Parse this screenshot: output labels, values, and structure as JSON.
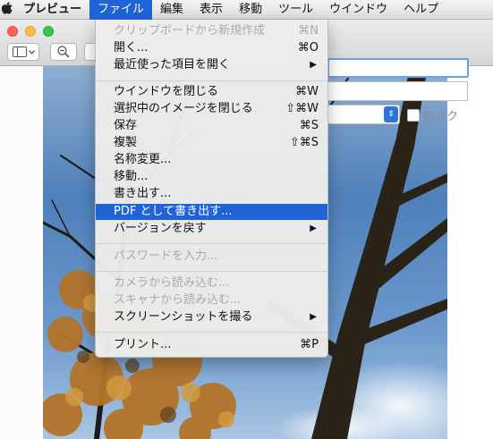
{
  "menubar": {
    "apple_icon": "apple-logo-icon",
    "items": [
      "プレビュー",
      "ファイル",
      "編集",
      "表示",
      "移動",
      "ツール",
      "ウインドウ",
      "ヘルプ"
    ]
  },
  "toolbar": {
    "sidebar_icon": "sidebar-toggle-icon",
    "chevron_icon": "chevron-down-icon",
    "zoom_icon": "zoom-out-icon"
  },
  "inspector": {
    "lock_label": "ロック",
    "select_icon": "updown-chevron-icon"
  },
  "file_menu": {
    "items": [
      {
        "label": "クリップボードから新規作成",
        "shortcut": "⌘N",
        "enabled": false
      },
      {
        "label": "開く...",
        "shortcut": "⌘O",
        "enabled": true
      },
      {
        "label": "最近使った項目を開く",
        "shortcut": "",
        "submenu": true,
        "enabled": true
      },
      {
        "label": "ウインドウを閉じる",
        "shortcut": "⌘W",
        "enabled": true
      },
      {
        "label": "選択中のイメージを閉じる",
        "shortcut": "⇧⌘W",
        "enabled": true
      },
      {
        "label": "保存",
        "shortcut": "⌘S",
        "enabled": true
      },
      {
        "label": "複製",
        "shortcut": "⇧⌘S",
        "enabled": true
      },
      {
        "label": "名称変更...",
        "shortcut": "",
        "enabled": true
      },
      {
        "label": "移動...",
        "shortcut": "",
        "enabled": true
      },
      {
        "label": "書き出す...",
        "shortcut": "",
        "enabled": true
      },
      {
        "label": "PDF として書き出す...",
        "shortcut": "",
        "enabled": true,
        "highlighted": true
      },
      {
        "label": "バージョンを戻す",
        "shortcut": "",
        "submenu": true,
        "enabled": true
      },
      {
        "label": "パスワードを入力...",
        "shortcut": "",
        "enabled": false
      },
      {
        "label": "カメラから読み込む...",
        "shortcut": "",
        "enabled": false
      },
      {
        "label": "スキャナから読み込む...",
        "shortcut": "",
        "enabled": false
      },
      {
        "label": "スクリーンショットを撮る",
        "shortcut": "",
        "submenu": true,
        "enabled": true
      },
      {
        "label": "プリント...",
        "shortcut": "⌘P",
        "enabled": true
      }
    ]
  },
  "colors": {
    "highlight": "#1f63d6",
    "disabled_text": "#a9a9a9"
  }
}
